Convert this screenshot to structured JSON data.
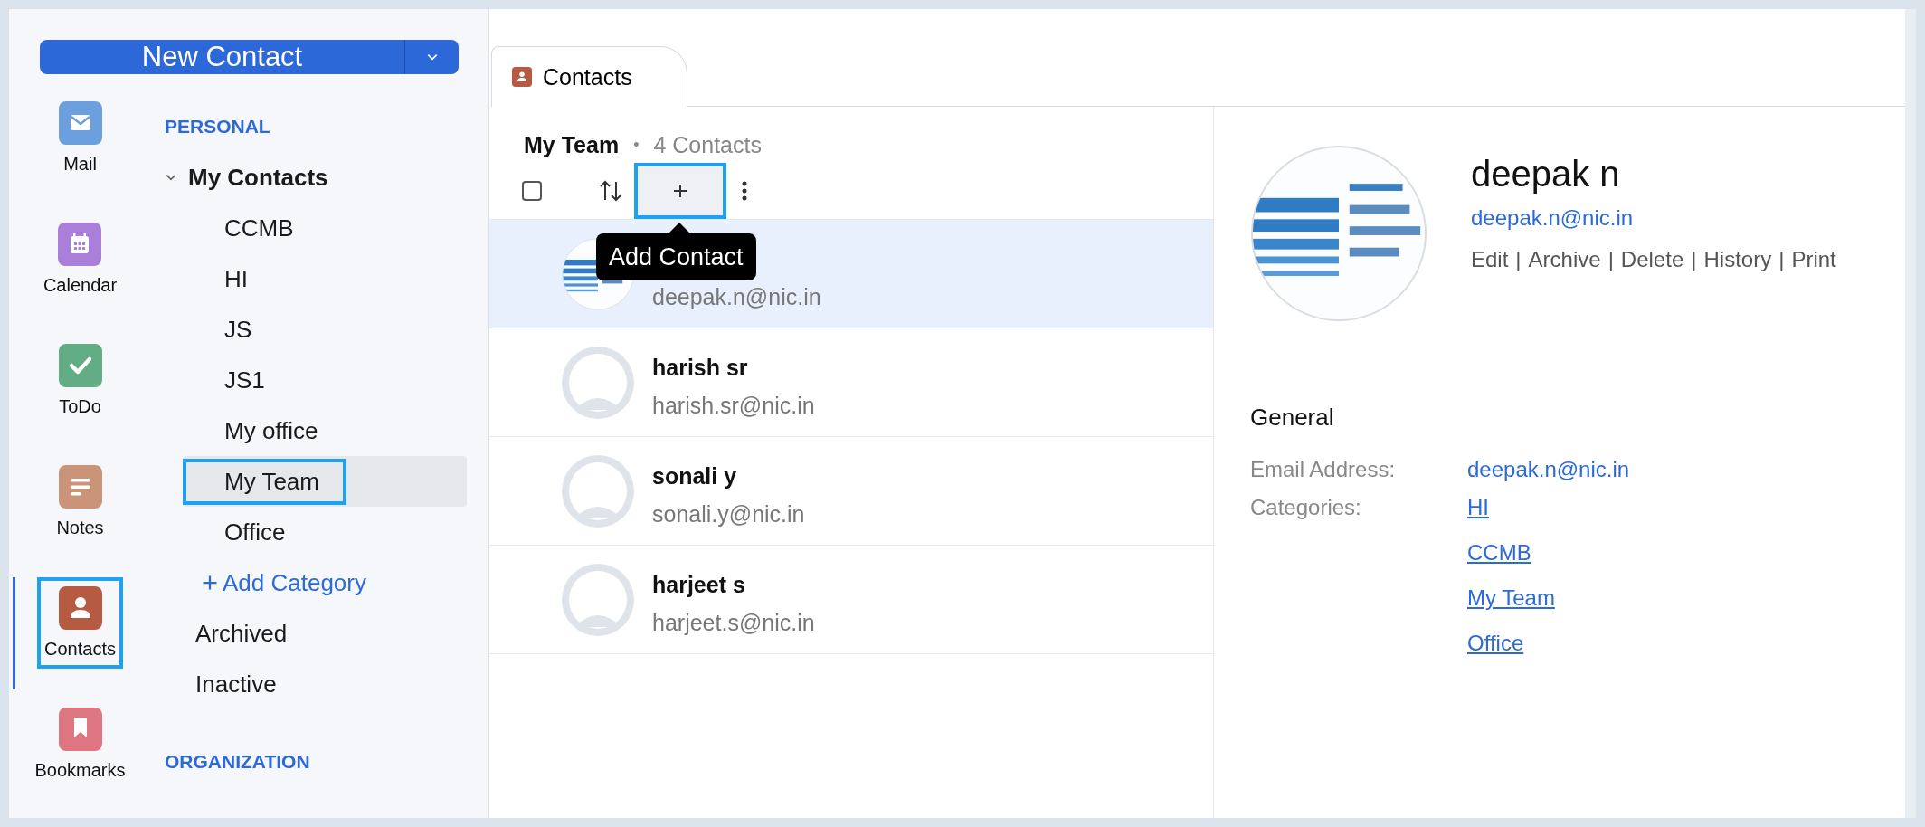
{
  "new_contact_button": {
    "label": "New Contact"
  },
  "apps": [
    {
      "label": "Mail",
      "kind": "mail",
      "selected": false,
      "highlighted": false
    },
    {
      "label": "Calendar",
      "kind": "calendar",
      "selected": false,
      "highlighted": false
    },
    {
      "label": "ToDo",
      "kind": "todo",
      "selected": false,
      "highlighted": false
    },
    {
      "label": "Notes",
      "kind": "notes",
      "selected": false,
      "highlighted": false
    },
    {
      "label": "Contacts",
      "kind": "contacts",
      "selected": true,
      "highlighted": true
    },
    {
      "label": "Bookmarks",
      "kind": "bookmarks",
      "selected": false,
      "highlighted": false
    }
  ],
  "sidebar": {
    "sections": [
      {
        "heading": "PERSONAL",
        "items": [
          {
            "label": "My Contacts",
            "kind": "folder",
            "expanded": true,
            "selected": false,
            "highlighted": false,
            "children": [
              {
                "label": "CCMB",
                "kind": "category",
                "selected": false,
                "highlighted": false
              },
              {
                "label": "HI",
                "kind": "category",
                "selected": false,
                "highlighted": false
              },
              {
                "label": "JS",
                "kind": "category",
                "selected": false,
                "highlighted": false
              },
              {
                "label": "JS1",
                "kind": "category",
                "selected": false,
                "highlighted": false
              },
              {
                "label": "My office",
                "kind": "category",
                "selected": false,
                "highlighted": false
              },
              {
                "label": "My Team",
                "kind": "category",
                "selected": true,
                "highlighted": true
              },
              {
                "label": "Office",
                "kind": "category",
                "selected": false,
                "highlighted": false
              },
              {
                "label": "Add Category",
                "kind": "add"
              }
            ]
          },
          {
            "label": "Archived",
            "kind": "plain",
            "selected": false,
            "highlighted": false
          },
          {
            "label": "Inactive",
            "kind": "plain",
            "selected": false,
            "highlighted": false
          }
        ]
      },
      {
        "heading": "ORGANIZATION"
      }
    ]
  },
  "tabs": [
    {
      "label": "Contacts",
      "selected": true
    }
  ],
  "list_header": {
    "title": "My Team",
    "separator": "•",
    "count": "4 Contacts"
  },
  "toolbar": {
    "select_all_checked": false,
    "add_button_highlighted": true,
    "tooltip": "Add Contact"
  },
  "contacts": [
    {
      "email": "deepak.n@nic.in",
      "kind": "picture",
      "selected": true
    },
    {
      "name": "harish sr",
      "email": "harish.sr@nic.in",
      "kind": "placeholder",
      "selected": false
    },
    {
      "name": "sonali y",
      "email": "sonali.y@nic.in",
      "kind": "placeholder",
      "selected": false
    },
    {
      "name": "harjeet s",
      "email": "harjeet.s@nic.in",
      "kind": "placeholder",
      "selected": false
    }
  ],
  "detail": {
    "name": "deepak n",
    "email": "deepak.n@nic.in",
    "actions": [
      "Edit",
      "Archive",
      "Delete",
      "History",
      "Print"
    ],
    "action_separator": "|",
    "section": "General",
    "fields": [
      {
        "label": "Email Address:",
        "kind": "email",
        "values": [
          "deepak.n@nic.in"
        ]
      },
      {
        "label": "Categories:",
        "kind": "links",
        "values": [
          "HI",
          "CCMB",
          "My Team",
          "Office"
        ]
      }
    ]
  }
}
